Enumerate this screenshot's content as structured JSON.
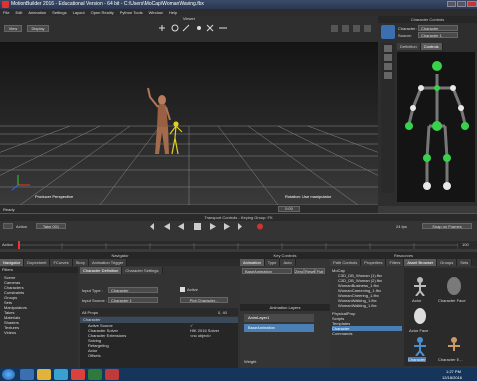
{
  "window": {
    "title": "MotionBuilder 2016 - Educational Version  -  64 bit  -  C:\\Users\\MoCap\\WomanWaving.fbx"
  },
  "menu": [
    "File",
    "Edit",
    "Animation",
    "Settings",
    "Layout",
    "Open Reality",
    "Python Tools",
    "Window",
    "Help"
  ],
  "viewer": {
    "title": "Viewer",
    "view_btn": "View",
    "display_btn": "Display",
    "camera_label": "Producer Perspective",
    "mode_label": "Rotation: Use manipulator",
    "status": "Ready"
  },
  "character_controls": {
    "title": "Character Controls",
    "character_label": "Character:",
    "character_value": "Character",
    "source_label": "Source:",
    "source_value": "Character 1",
    "tabs": [
      "Definition",
      "Controls"
    ]
  },
  "transport": {
    "title": "Transport Controls  -  Keying Group: FK",
    "action_label": "Action",
    "take": "Take 001",
    "fps": "24 fps",
    "snap": "Snap on Frames",
    "end_frame": "100",
    "time_field": "0:00"
  },
  "navigator": {
    "title": "Navigator",
    "tabs": [
      "Navigator",
      "Dopesheet",
      "FCurves",
      "Story",
      "Animation Trigger"
    ],
    "sub_tabs": [
      "Character Definition",
      "Character Settings"
    ],
    "input_type_label": "Input Type :",
    "input_type_value": "Character",
    "input_source_label": "Input Source :",
    "input_source_value": "Character 1",
    "active_label": "Active",
    "plot_btn": "Plot Character...",
    "filters_label": "Filters",
    "tree": [
      "Scene",
      "Cameras",
      "Characters",
      "Constraints",
      "Groups",
      "Sets",
      "Manipulators",
      "Takes",
      "Materials",
      "Shaders",
      "Textures",
      "Videos"
    ],
    "prop_header": "Character",
    "props": [
      {
        "name": "Active Source",
        "value": "✓"
      },
      {
        "name": "Character Solver",
        "value": "HIK 2016 Solver"
      },
      {
        "name": "Character Extensions",
        "value": "<no object>"
      },
      {
        "name": "Solving",
        "value": ""
      },
      {
        "name": "Retargeting",
        "value": ""
      },
      {
        "name": "Actor",
        "value": ""
      },
      {
        "name": "Offsets",
        "value": ""
      }
    ],
    "prop_filter": "All Props",
    "prop_val": "0, 40"
  },
  "key_controls": {
    "title": "Key Controls",
    "tabs": [
      "Animation",
      "Type",
      "Auto"
    ],
    "layer_value": "BaseAnimation",
    "btns": [
      "Zero",
      "Reset",
      "Flat"
    ],
    "anim_layers_title": "Animation Layers",
    "layer1": "AnimLayer1",
    "layer2": "BaseAnimation",
    "weight_label": "Weight"
  },
  "resources": {
    "title": "Resources",
    "tabs": [
      "Path Controls",
      "Properties",
      "Filters",
      "Asset Browser",
      "Groups",
      "Sets"
    ],
    "tree": [
      "MoCap",
      "C3D_DB_Woman (1).fbx",
      "C3D_DB_Woman (2).fbx",
      "WomanBusiness_1.fbx",
      "WomanCareening_1.fbx",
      "WomanCheering_1.fbx",
      "WomanWalking_1.fbx",
      "WomanWalking_1.fbx"
    ],
    "left_tree": [
      "PhysicalProp",
      "Scripts",
      "Templates",
      "Character",
      "Commands"
    ],
    "icons": [
      {
        "label": "Actor"
      },
      {
        "label": "Character Face"
      },
      {
        "label": "Actor Face"
      },
      {
        "label": "Character"
      },
      {
        "label": "Character E..."
      }
    ]
  },
  "taskbar": {
    "time": "1:27 PM",
    "date": "12/18/2016"
  }
}
